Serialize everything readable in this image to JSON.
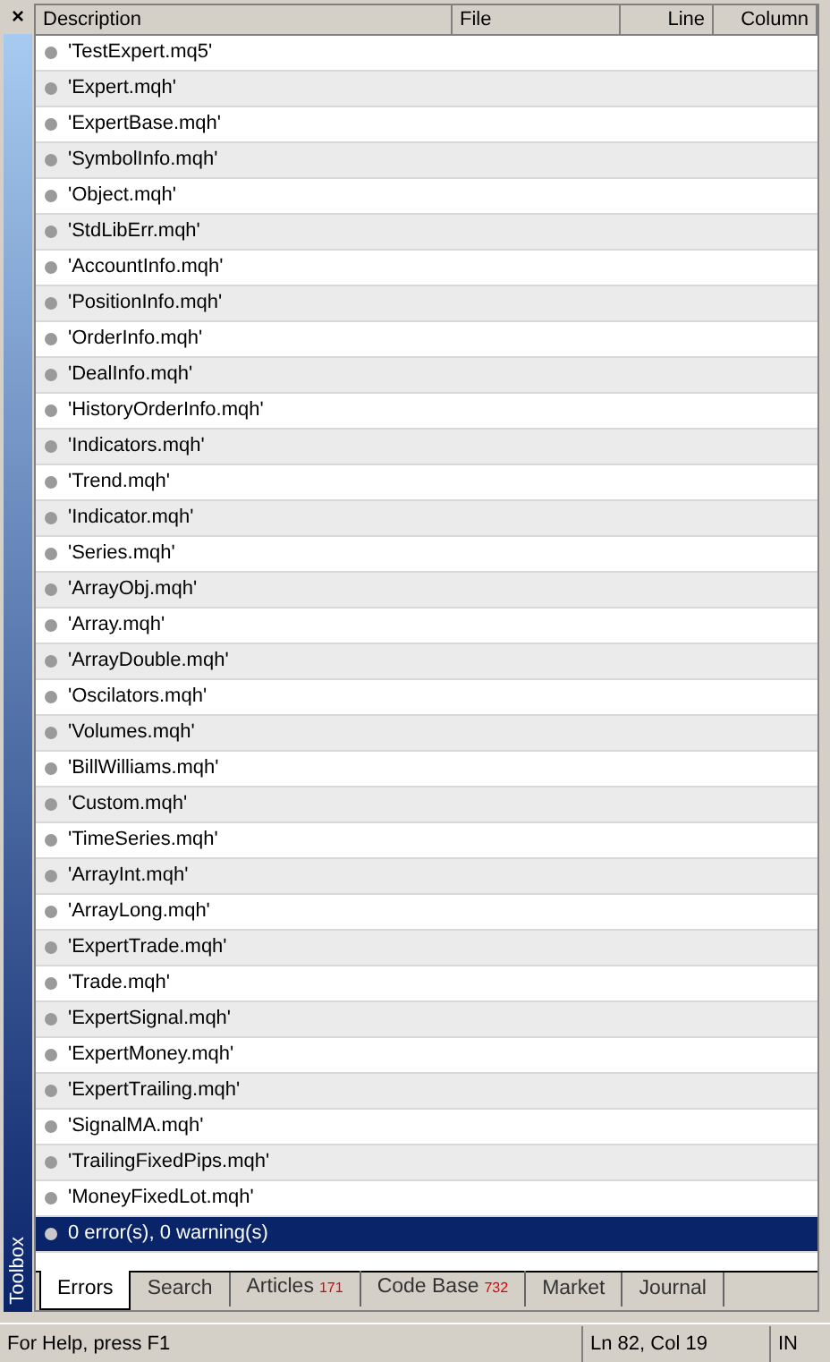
{
  "panel": {
    "close": "×",
    "title": "Toolbox"
  },
  "table": {
    "columns": [
      "Description",
      "File",
      "Line",
      "Column"
    ],
    "rows": [
      {
        "description": "'TestExpert.mq5'",
        "selected": false
      },
      {
        "description": "'Expert.mqh'",
        "selected": false
      },
      {
        "description": "'ExpertBase.mqh'",
        "selected": false
      },
      {
        "description": "'SymbolInfo.mqh'",
        "selected": false
      },
      {
        "description": "'Object.mqh'",
        "selected": false
      },
      {
        "description": "'StdLibErr.mqh'",
        "selected": false
      },
      {
        "description": "'AccountInfo.mqh'",
        "selected": false
      },
      {
        "description": "'PositionInfo.mqh'",
        "selected": false
      },
      {
        "description": "'OrderInfo.mqh'",
        "selected": false
      },
      {
        "description": "'DealInfo.mqh'",
        "selected": false
      },
      {
        "description": "'HistoryOrderInfo.mqh'",
        "selected": false
      },
      {
        "description": "'Indicators.mqh'",
        "selected": false
      },
      {
        "description": "'Trend.mqh'",
        "selected": false
      },
      {
        "description": "'Indicator.mqh'",
        "selected": false
      },
      {
        "description": "'Series.mqh'",
        "selected": false
      },
      {
        "description": "'ArrayObj.mqh'",
        "selected": false
      },
      {
        "description": "'Array.mqh'",
        "selected": false
      },
      {
        "description": "'ArrayDouble.mqh'",
        "selected": false
      },
      {
        "description": "'Oscilators.mqh'",
        "selected": false
      },
      {
        "description": "'Volumes.mqh'",
        "selected": false
      },
      {
        "description": "'BillWilliams.mqh'",
        "selected": false
      },
      {
        "description": "'Custom.mqh'",
        "selected": false
      },
      {
        "description": "'TimeSeries.mqh'",
        "selected": false
      },
      {
        "description": "'ArrayInt.mqh'",
        "selected": false
      },
      {
        "description": "'ArrayLong.mqh'",
        "selected": false
      },
      {
        "description": "'ExpertTrade.mqh'",
        "selected": false
      },
      {
        "description": "'Trade.mqh'",
        "selected": false
      },
      {
        "description": "'ExpertSignal.mqh'",
        "selected": false
      },
      {
        "description": "'ExpertMoney.mqh'",
        "selected": false
      },
      {
        "description": "'ExpertTrailing.mqh'",
        "selected": false
      },
      {
        "description": "'SignalMA.mqh'",
        "selected": false
      },
      {
        "description": "'TrailingFixedPips.mqh'",
        "selected": false
      },
      {
        "description": "'MoneyFixedLot.mqh'",
        "selected": false
      },
      {
        "description": "0 error(s), 0 warning(s)",
        "selected": true
      }
    ]
  },
  "tabs": [
    {
      "label": "Errors",
      "selected": true
    },
    {
      "label": "Search",
      "selected": false
    },
    {
      "label": "Articles",
      "count": "171",
      "selected": false
    },
    {
      "label": "Code Base",
      "count": "732",
      "selected": false
    },
    {
      "label": "Market",
      "selected": false
    },
    {
      "label": "Journal",
      "selected": false
    }
  ],
  "status_bar": {
    "help": "For Help, press F1",
    "position": "Ln 82, Col 19",
    "mode": "IN"
  }
}
